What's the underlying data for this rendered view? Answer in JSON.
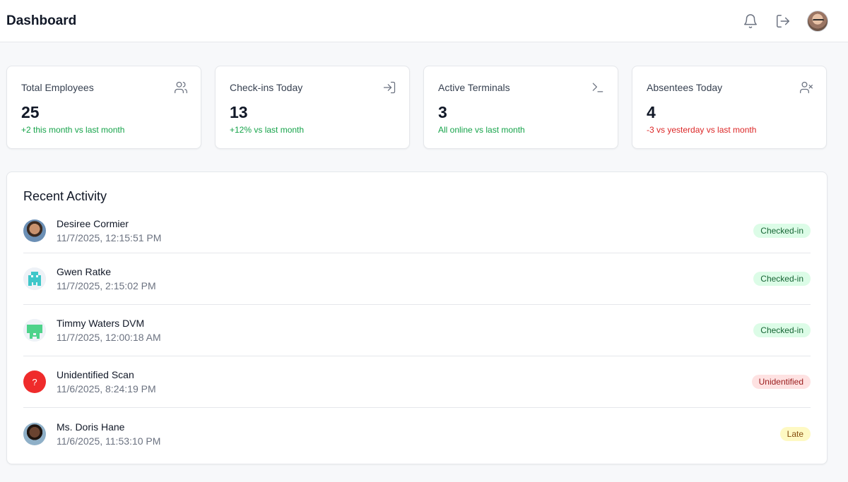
{
  "header": {
    "title": "Dashboard",
    "icons": [
      "bell-icon",
      "logout-icon",
      "user-avatar"
    ]
  },
  "stats": [
    {
      "title": "Total Employees",
      "value": "25",
      "sub": "+2 this month vs last month",
      "trend": "positive",
      "icon": "users-icon"
    },
    {
      "title": "Check-ins Today",
      "value": "13",
      "sub": "+12% vs last month",
      "trend": "positive",
      "icon": "login-icon"
    },
    {
      "title": "Active Terminals",
      "value": "3",
      "sub": "All online vs last month",
      "trend": "positive",
      "icon": "terminal-icon"
    },
    {
      "title": "Absentees Today",
      "value": "4",
      "sub": "-3 vs yesterday vs last month",
      "trend": "negative",
      "icon": "user-x-icon"
    }
  ],
  "activity": {
    "title": "Recent Activity",
    "items": [
      {
        "name": "Desiree Cormier",
        "time": "11/7/2025, 12:15:51 PM",
        "status": "Checked-in",
        "avatar": "photo"
      },
      {
        "name": "Gwen Ratke",
        "time": "11/7/2025, 2:15:02 PM",
        "status": "Checked-in",
        "avatar": "identicon-teal"
      },
      {
        "name": "Timmy Waters DVM",
        "time": "11/7/2025, 12:00:18 AM",
        "status": "Checked-in",
        "avatar": "identicon-green"
      },
      {
        "name": "Unidentified Scan",
        "time": "11/6/2025, 8:24:19 PM",
        "status": "Unidentified",
        "avatar": "question-mark",
        "avatar_glyph": "?"
      },
      {
        "name": "Ms. Doris Hane",
        "time": "11/6/2025, 11:53:10 PM",
        "status": "Late",
        "avatar": "photo"
      }
    ]
  },
  "colors": {
    "positive": "#16a34a",
    "negative": "#dc2626",
    "badge_checked_in": "#dcfce7",
    "badge_unidentified": "#fee2e2",
    "badge_late": "#fef9c3",
    "unidentified_avatar": "#ef2b2b"
  }
}
